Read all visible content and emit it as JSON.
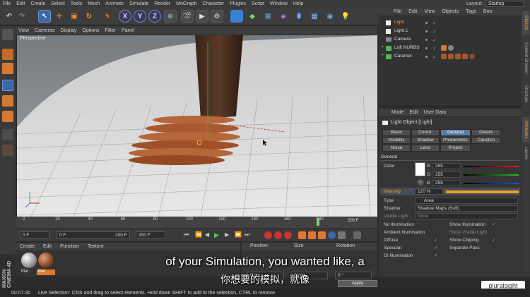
{
  "menu": [
    "File",
    "Edit",
    "Create",
    "Select",
    "Tools",
    "Mesh",
    "Animate",
    "Simulate",
    "Render",
    "MoGraph",
    "Character",
    "Plugins",
    "Script",
    "Window",
    "Help"
  ],
  "layout": {
    "label": "Layout:",
    "value": "Startup"
  },
  "toolbar": {
    "axis_x": "X",
    "axis_y": "Y",
    "axis_z": "Z"
  },
  "viewport": {
    "menu": [
      "View",
      "Cameras",
      "Display",
      "Options",
      "Filter",
      "Panel"
    ],
    "label": "Perspective"
  },
  "timeline": {
    "ticks": [
      "0",
      "20",
      "40",
      "60",
      "80",
      "100",
      "120",
      "140",
      "160",
      "180"
    ],
    "end_label": "200 F",
    "current_frame": "0 F",
    "min_frame": "0 F",
    "preview_max": "200 F",
    "max_frame": "200 F",
    "playhead_fraction": 0.9
  },
  "materials": {
    "menu": [
      "Create",
      "Edit",
      "Function",
      "Texture"
    ],
    "items": [
      {
        "name": "Mat",
        "color": "#a0a0a0"
      },
      {
        "name": "Mat",
        "color": "#8a4a2a"
      }
    ]
  },
  "coords": {
    "headers": [
      "Position",
      "Size",
      "Rotation"
    ],
    "pos_value": "0 cm",
    "size_value": "0 cm",
    "rot_value": "0 °",
    "apply_label": "Apply"
  },
  "objects": {
    "menu": [
      "File",
      "Edit",
      "View",
      "Objects",
      "Tags",
      "Boo"
    ],
    "items": [
      {
        "name": "Light",
        "selected": true
      },
      {
        "name": "Light.1",
        "selected": false
      },
      {
        "name": "Camera",
        "selected": false
      },
      {
        "name": "Loft NURBS",
        "selected": false
      },
      {
        "name": "Caramel",
        "selected": false
      }
    ]
  },
  "side_tabs": [
    "Objects",
    "Content Browser",
    "Structure",
    "Attributes",
    "Layers"
  ],
  "attributes": {
    "menu": [
      "Mode",
      "Edit",
      "User Data"
    ],
    "title": "Light Object [Light]",
    "tabs_row1": [
      "Basic",
      "Coord.",
      "General",
      "Details"
    ],
    "tabs_row2": [
      "Visibility",
      "Shadow",
      "Photometric",
      "Caustics"
    ],
    "tabs_row3": [
      "Noise",
      "Lens",
      "Project"
    ],
    "active_tab": "General",
    "section": "General",
    "color_label": "Color",
    "r_label": "R",
    "r_value": "255",
    "g_label": "G",
    "g_value": "255",
    "b_label": "B",
    "b_value": "255",
    "intensity_label": "Intensity",
    "intensity_value": "120 %",
    "type_label": "Type",
    "type_value": "Area",
    "shadow_label": "Shadow",
    "shadow_value": "Shadow Maps (Soft)",
    "visible_light_label": "Visible Light",
    "visible_light_value": "None",
    "checks_left": [
      "No Illumination",
      "Ambient Illumination",
      "Diffuse",
      "Specular",
      "GI Illumination"
    ],
    "checks_right": [
      "Show Illumination",
      "Show Visible Light",
      "Show Clipping",
      "Separate Pass"
    ]
  },
  "status": {
    "time": "00:07:30",
    "message": "Live Selection: Click and drag to select elements. Hold down SHIFT to add to the selection, CTRL to remove."
  },
  "subtitle": {
    "en": "of your Simulation, you wanted like, a",
    "zh": "你想要的模拟，就像"
  },
  "brand": {
    "watermark": "pluralsight",
    "logo": "MAXON CINEMA 4D"
  },
  "colors": {
    "accent": "#ff9d2a",
    "tab_active": "#5b7ea8",
    "caramel": "#a0522d"
  }
}
